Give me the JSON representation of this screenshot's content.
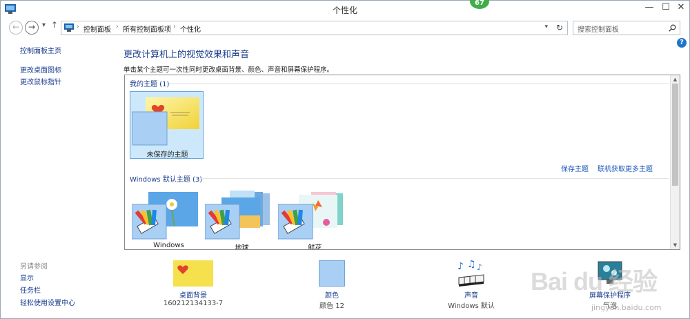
{
  "window": {
    "title": "个性化",
    "badge": "67"
  },
  "titlebar": {
    "minimize": "—",
    "maximize": "☐",
    "close": "✕"
  },
  "nav": {
    "back": "←",
    "forward": "→",
    "dropdown": "▾",
    "up": "↑",
    "refresh": "↻"
  },
  "address": {
    "crumbs": [
      "控制面板",
      "所有控制面板项",
      "个性化"
    ],
    "separator": "›"
  },
  "search": {
    "placeholder": "搜索控制面板",
    "icon": "search-icon"
  },
  "help": {
    "label": "?"
  },
  "left_nav": {
    "links": [
      "控制面板主页",
      "更改桌面图标",
      "更改鼠标指针"
    ],
    "see_also_label": "另请参阅",
    "see_also": [
      "显示",
      "任务栏",
      "轻松使用设置中心"
    ]
  },
  "main": {
    "heading": "更改计算机上的视觉效果和声音",
    "description": "单击某个主题可一次性同时更改桌面背景、颜色、声音和屏幕保护程序。"
  },
  "themes": {
    "my_group": "我的主题 (1)",
    "my_items": [
      {
        "label": "未保存的主题"
      }
    ],
    "save_theme": "保存主题",
    "get_more": "联机获取更多主题",
    "default_group": "Windows 默认主题 (3)",
    "default_items": [
      {
        "label": "Windows"
      },
      {
        "label": "地球"
      },
      {
        "label": "鲜花"
      }
    ]
  },
  "bottom": [
    {
      "title": "桌面背景",
      "sub": "160212134133-7"
    },
    {
      "title": "颜色",
      "sub": "颜色 12"
    },
    {
      "title": "声音",
      "sub": "Windows 默认"
    },
    {
      "title": "屏幕保护程序",
      "sub": "气泡"
    }
  ],
  "watermark": {
    "text": "Bai du 经验",
    "sub": "jingyan.baidu.com"
  },
  "colors": {
    "link": "#1b3f8f",
    "selection": "#cde8fb",
    "badge": "#3fae49"
  }
}
